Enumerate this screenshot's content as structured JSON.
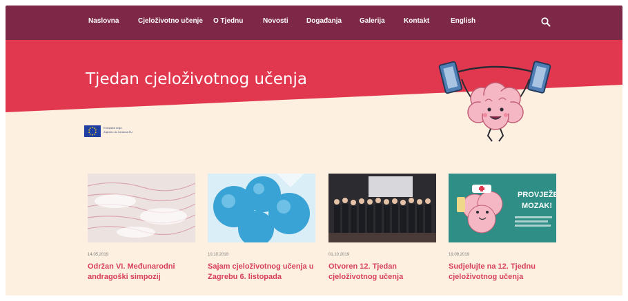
{
  "nav": {
    "items": [
      {
        "label": "Naslovna"
      },
      {
        "label": "Cjeloživotno učenje"
      },
      {
        "label": "O Tjednu"
      },
      {
        "label": "Novosti"
      },
      {
        "label": "Događanja"
      },
      {
        "label": "Galerija"
      },
      {
        "label": "Kontakt"
      },
      {
        "label": "English"
      }
    ],
    "search_icon": "search-icon"
  },
  "hero": {
    "title": "Tjedan cjeloživotnog učenja"
  },
  "eu": {
    "line1": "Europska unija",
    "line2": "Zajedno do fondova EU"
  },
  "cards": [
    {
      "date": "14.05.2019",
      "title": "Održan VI. Međunarodni andragoški simpozij"
    },
    {
      "date": "10.10.2019",
      "title": "Sajam cjeloživotnog učenja u Zagrebu 6. listopada"
    },
    {
      "date": "01.10.2019",
      "title": "Otvoren 12. Tjedan cjeloživotnog učenja"
    },
    {
      "date": "19.09.2019",
      "title": "Sudjelujte na 12. Tjednu cjeloživotnog učenja"
    }
  ],
  "card4_poster": {
    "line1": "PROVJEŽBAJ",
    "line2": "MOZAK!"
  },
  "colors": {
    "nav": "#7d2846",
    "hero": "#e2384f",
    "background": "#fdf0e0",
    "link": "#d8405a"
  }
}
